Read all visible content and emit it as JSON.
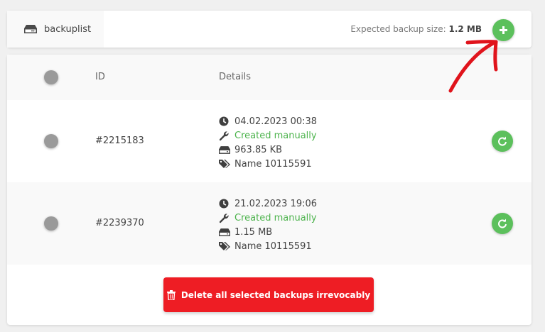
{
  "header": {
    "tab_label": "backuplist",
    "expected_label": "Expected backup size:",
    "expected_value": "1.2 MB",
    "add_icon": "plus-icon"
  },
  "table": {
    "columns": [
      "ID",
      "Details"
    ],
    "rows": [
      {
        "id": "#2215183",
        "date": "04.02.2023 00:38",
        "type": "Created manually",
        "size": "963.85 KB",
        "name": "Name 10115591"
      },
      {
        "id": "#2239370",
        "date": "21.02.2023 19:06",
        "type": "Created manually",
        "size": "1.15 MB",
        "name": "Name 10115591"
      }
    ]
  },
  "actions": {
    "delete_label": "Delete all selected backups irrevocably"
  },
  "colors": {
    "accent_green": "#5cc05c",
    "text_green": "#4cb34c",
    "danger_red": "#ee1d24",
    "annotation_red": "#e0141c"
  }
}
